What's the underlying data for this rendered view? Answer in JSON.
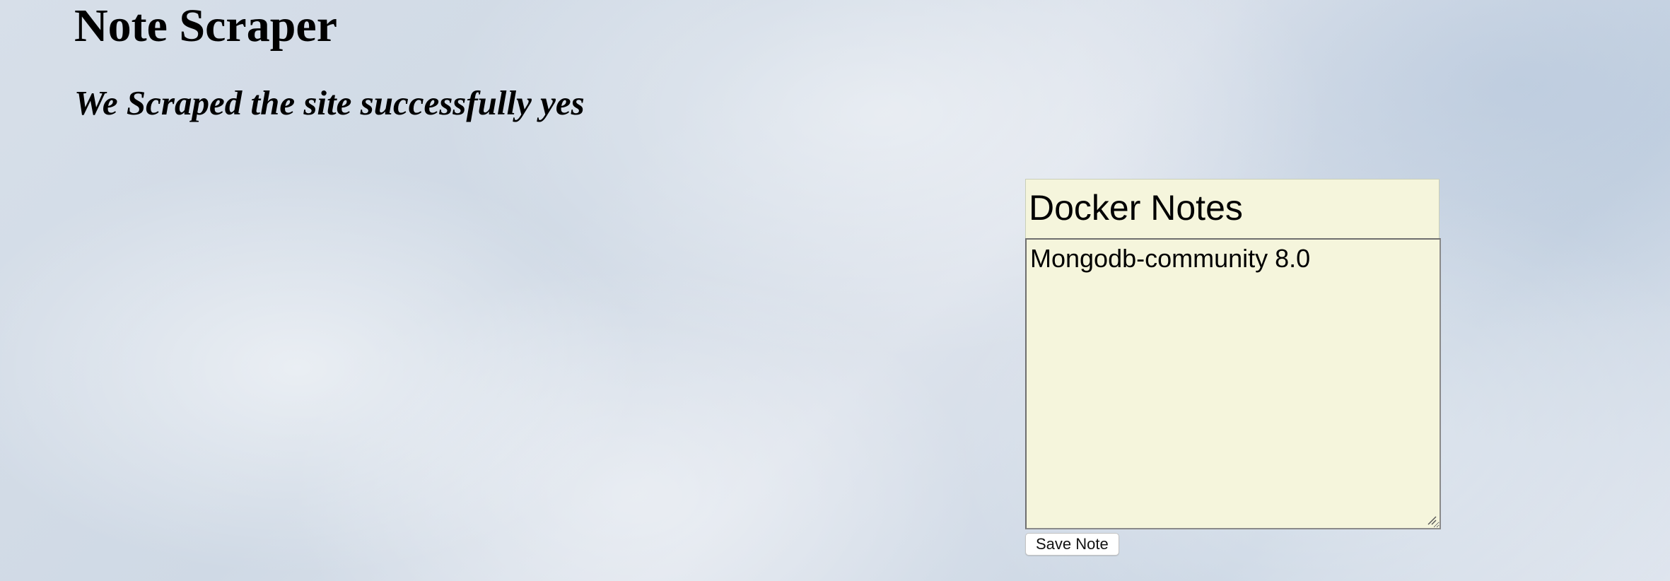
{
  "page": {
    "title": "Note Scraper",
    "status_message": "We Scraped the site successfully yes",
    "background_color": "#d7dfe9"
  },
  "note_form": {
    "title_value": "Docker Notes",
    "body_value": "Mongodb-community 8.0",
    "save_label": "Save Note",
    "note_background": "#f5f5dc"
  }
}
